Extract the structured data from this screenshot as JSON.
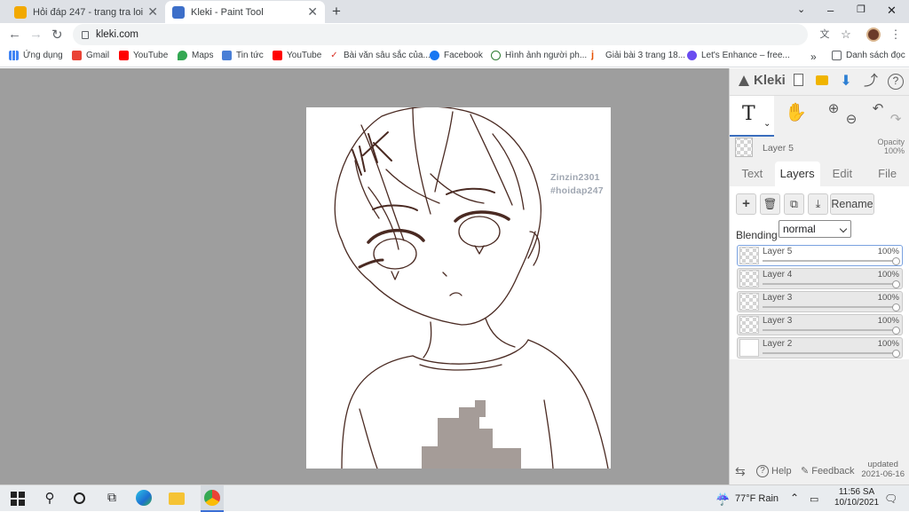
{
  "browser": {
    "tabs": [
      {
        "title": "Hỏi đáp 247 - trang tra loi"
      },
      {
        "title": "Kleki - Paint Tool"
      }
    ],
    "url": "kleki.com",
    "bookmarks": [
      {
        "label": "Ứng dụng"
      },
      {
        "label": "Gmail"
      },
      {
        "label": "YouTube"
      },
      {
        "label": "Maps"
      },
      {
        "label": "Tin tức"
      },
      {
        "label": "YouTube"
      },
      {
        "label": "Bài văn sâu sắc của..."
      },
      {
        "label": "Facebook"
      },
      {
        "label": "Hình ảnh người ph..."
      },
      {
        "label": "Giải bài 3 trang 18..."
      },
      {
        "label": "Let's Enhance – free..."
      }
    ],
    "bookmarks_more": "»",
    "reading_list": "Danh sách đọc"
  },
  "canvas": {
    "watermark_line1": "Zinzin2301",
    "watermark_line2": "#hoidap247"
  },
  "kleki": {
    "brand": "Kleki",
    "current_layer": "Layer 5",
    "opacity_label": "Opacity",
    "opacity_value": "100%",
    "tabs": [
      "Text",
      "Layers",
      "Edit",
      "File"
    ],
    "active_tab": "Layers",
    "rename_label": "Rename",
    "blending_label": "Blending",
    "blending_value": "normal",
    "layers": [
      {
        "name": "Layer 5",
        "opacity": "100%",
        "selected": true
      },
      {
        "name": "Layer 4",
        "opacity": "100%"
      },
      {
        "name": "Layer 3",
        "opacity": "100%"
      },
      {
        "name": "Layer 3",
        "opacity": "100%"
      },
      {
        "name": "Layer 2",
        "opacity": "100%"
      }
    ],
    "help_label": "Help",
    "feedback_label": "Feedback",
    "updated_line1": "updated",
    "updated_line2": "2021-06-16"
  },
  "taskbar": {
    "weather": "77°F  Rain",
    "time": "11:56 SA",
    "date": "10/10/2021"
  }
}
